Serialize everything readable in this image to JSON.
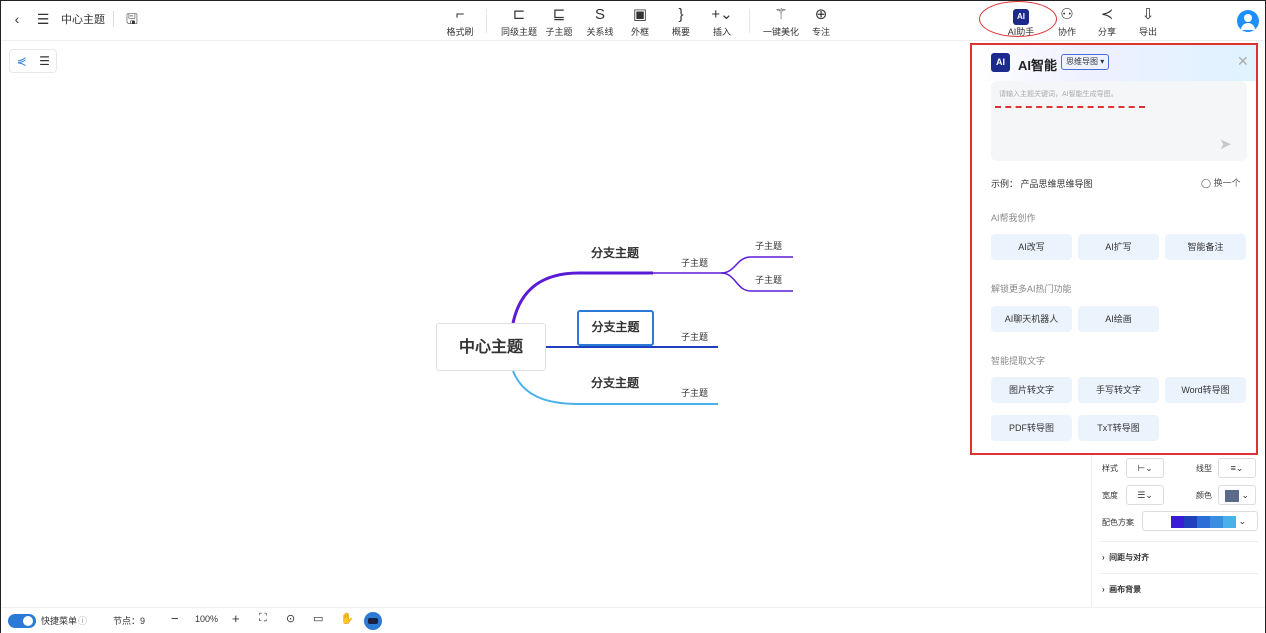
{
  "topbar": {
    "doc_title": "中心主题",
    "tools": [
      {
        "label": "格式刷",
        "icon": "format-brush-icon"
      },
      {
        "label": "同级主题",
        "icon": "sibling-topic-icon"
      },
      {
        "label": "子主题",
        "icon": "subtopic-icon"
      },
      {
        "label": "关系线",
        "icon": "relation-line-icon"
      },
      {
        "label": "外框",
        "icon": "boundary-icon"
      },
      {
        "label": "概要",
        "icon": "summary-icon"
      },
      {
        "label": "插入",
        "icon": "plus-icon"
      },
      {
        "label": "一键美化",
        "icon": "magic-wand-icon"
      },
      {
        "label": "专注",
        "icon": "focus-icon"
      },
      {
        "label": "AI助手",
        "icon": "ai-icon"
      },
      {
        "label": "协作",
        "icon": "collaborate-icon"
      },
      {
        "label": "分享",
        "icon": "share-icon"
      },
      {
        "label": "导出",
        "icon": "export-icon"
      }
    ]
  },
  "mindmap": {
    "center": "中心主题",
    "branches": [
      {
        "label": "分支主题",
        "children": [
          "子主题"
        ],
        "grandchildren": [
          "子主题",
          "子主题"
        ]
      },
      {
        "label": "分支主题",
        "children": [
          "子主题"
        ]
      },
      {
        "label": "分支主题",
        "children": [
          "子主题"
        ]
      }
    ],
    "colors": {
      "branch1": "#5b1bd6",
      "branch2": "#1f3fbf",
      "branch3": "#4ab0ea"
    }
  },
  "ai_panel": {
    "logo": "AI",
    "title": "AI智能",
    "mode": "思维导图 ▾",
    "placeholder": "请输入主题关键词，AI智能生成导图。",
    "example": "示例： 产品思维思维导图",
    "refresh": "换一个",
    "sections": [
      {
        "title": "AI帮我创作",
        "items": [
          "AI改写",
          "AI扩写",
          "智能备注"
        ]
      },
      {
        "title": "解锁更多AI热门功能",
        "items": [
          "AI聊天机器人",
          "AI绘画"
        ]
      },
      {
        "title": "智能提取文字",
        "items": [
          "图片转文字",
          "手写转文字",
          "Word转导图",
          "PDF转导图",
          "TxT转导图"
        ]
      }
    ]
  },
  "props": {
    "style_label": "样式",
    "linetype_label": "线型",
    "width_label": "宽度",
    "color_label": "颜色",
    "scheme_label": "配色方案",
    "spacing_label": "间距与对齐",
    "background_label": "画布背景",
    "color_value": "#5b6a8a",
    "scheme_colors": [
      "#3a1bd6",
      "#1f3fbf",
      "#2b6fd6",
      "#3a8ee0",
      "#4ab0ea"
    ]
  },
  "bottom": {
    "shortcut_label": "快捷菜单",
    "node_count": "节点：9",
    "zoom": "100%"
  }
}
